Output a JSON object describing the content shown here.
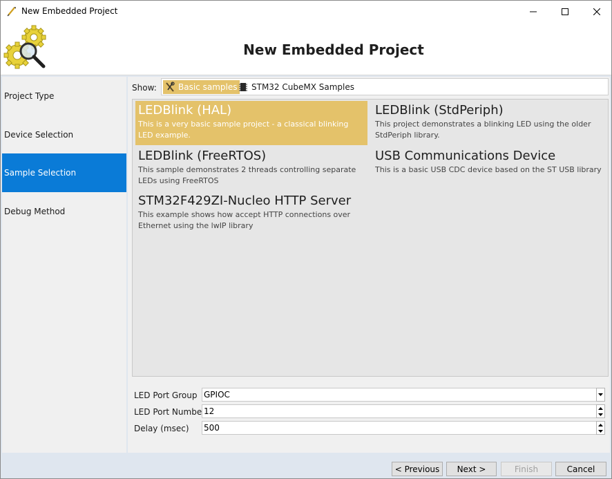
{
  "window": {
    "title": "New Embedded Project",
    "icon": "pencil-wrench-icon"
  },
  "header": {
    "title": "New Embedded Project",
    "logo": "gears-magnifier-logo"
  },
  "nav": {
    "items": [
      {
        "label": "Project Type",
        "active": false
      },
      {
        "label": "Device Selection",
        "active": false
      },
      {
        "label": "Sample Selection",
        "active": true
      },
      {
        "label": "Debug Method",
        "active": false
      }
    ]
  },
  "show": {
    "label": "Show:",
    "tabs": [
      {
        "label": "Basic samples",
        "icon": "tools-icon",
        "selected": true
      },
      {
        "label": "STM32 CubeMX Samples",
        "icon": "chip-icon",
        "selected": false
      }
    ]
  },
  "samples": [
    {
      "title": "LEDBlink (HAL)",
      "desc": "This is a very basic sample project - a classical blinking LED example.",
      "selected": true
    },
    {
      "title": "LEDBlink (StdPeriph)",
      "desc": "This project demonstrates a blinking LED using the older StdPeriph library.",
      "selected": false
    },
    {
      "title": "LEDBlink (FreeRTOS)",
      "desc": "This sample demonstrates 2 threads controlling separate LEDs using FreeRTOS",
      "selected": false
    },
    {
      "title": "USB Communications Device",
      "desc": "This is a basic USB CDC device based on the ST USB library",
      "selected": false
    },
    {
      "title": "STM32F429ZI-Nucleo HTTP Server",
      "desc": "This example shows how accept HTTP connections over Ethernet using the lwIP library",
      "selected": false
    }
  ],
  "properties": [
    {
      "label": "LED Port Group",
      "value": "GPIOC",
      "control": "dropdown"
    },
    {
      "label": "LED Port Number",
      "value": "12",
      "control": "spinner"
    },
    {
      "label": "Delay (msec)",
      "value": "500",
      "control": "spinner"
    }
  ],
  "footer": {
    "previous_label": "< Previous",
    "next_label": "Next >",
    "finish_label": "Finish",
    "cancel_label": "Cancel"
  },
  "colors": {
    "accent_blue": "#0a7bd7",
    "selection_gold": "#e4c26a",
    "panel_bg": "#dfe6ef"
  }
}
